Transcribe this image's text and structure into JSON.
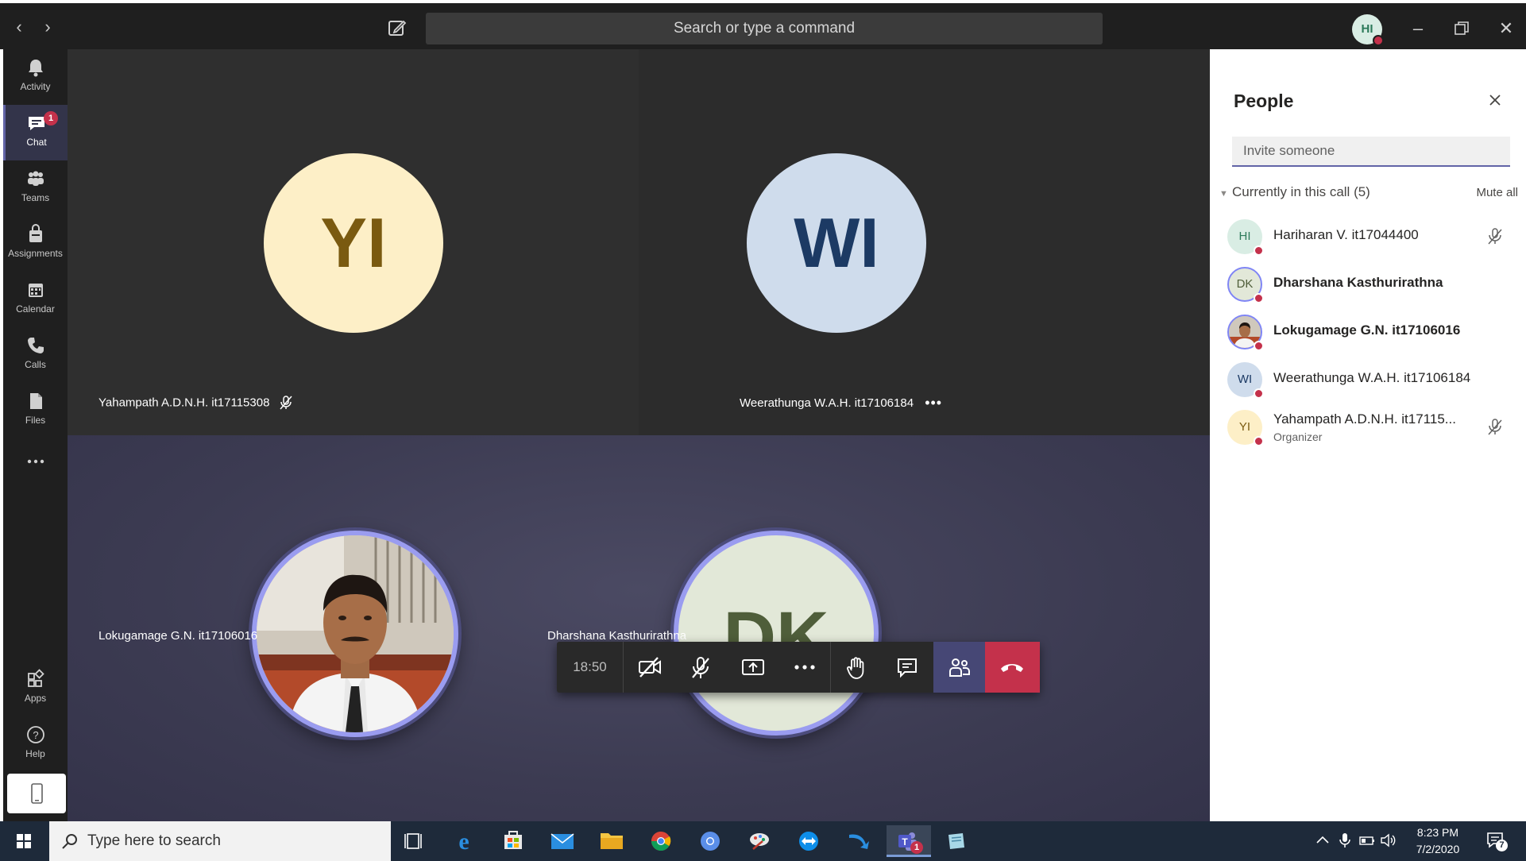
{
  "titlebar": {
    "search_placeholder": "Search or type a command",
    "me_initials": "HI"
  },
  "rail": {
    "items": [
      {
        "label": "Activity",
        "icon": "bell-icon"
      },
      {
        "label": "Chat",
        "icon": "chat-icon",
        "badge": "1"
      },
      {
        "label": "Teams",
        "icon": "teams-icon"
      },
      {
        "label": "Assignments",
        "icon": "assignments-icon"
      },
      {
        "label": "Calendar",
        "icon": "calendar-icon"
      },
      {
        "label": "Calls",
        "icon": "phone-icon"
      },
      {
        "label": "Files",
        "icon": "files-icon"
      },
      {
        "label": "...",
        "icon": "more-icon"
      },
      {
        "label": "Apps",
        "icon": "apps-icon"
      },
      {
        "label": "Help",
        "icon": "help-icon"
      }
    ]
  },
  "stage": {
    "tiles": [
      {
        "initials": "YI",
        "name": "Yahampath A.D.N.H. it17115308",
        "muted": true
      },
      {
        "initials": "WI",
        "name": "Weerathunga W.A.H. it17106184"
      },
      {
        "name": "Lokugamage G.N. it17106016"
      },
      {
        "initials": "DK",
        "name": "Dharshana Kasthurirathna"
      }
    ]
  },
  "controls": {
    "timer": "18:50"
  },
  "people": {
    "title": "People",
    "invite_placeholder": "Invite someone",
    "section_label": "Currently in this call",
    "count": "(5)",
    "mute_all": "Mute all",
    "list": [
      {
        "initials": "HI",
        "name": "Hariharan V. it17044400",
        "muted": true
      },
      {
        "initials": "DK",
        "name": "Dharshana Kasthurirathna",
        "bold": true
      },
      {
        "initials": "",
        "name": "Lokugamage G.N. it17106016",
        "bold": true
      },
      {
        "initials": "WI",
        "name": "Weerathunga W.A.H. it17106184"
      },
      {
        "initials": "YI",
        "name": "Yahampath A.D.N.H. it17115...",
        "role": "Organizer",
        "muted": true
      }
    ]
  },
  "taskbar": {
    "search_placeholder": "Type here to search",
    "time": "8:23 PM",
    "date": "7/2/2020",
    "teams_badge": "1",
    "notif_count": "7"
  },
  "colors": {
    "accent": "#6264a7",
    "alert": "#c4314b",
    "dark": "#1f1f1f"
  }
}
